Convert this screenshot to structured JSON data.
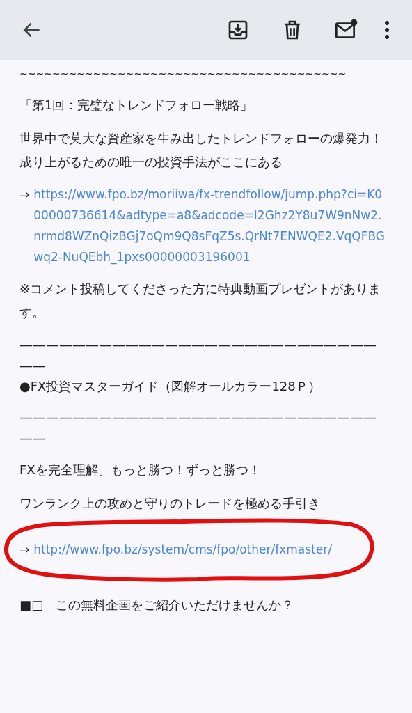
{
  "blocks": [
    {
      "kind": "tilde_rule",
      "text": "~~~~~~~~~~~~~~~~~~~~~~~~~~~~~~~~~~~~~~~~"
    },
    {
      "kind": "text",
      "text": "「第1回：完璧なトレンドフォロー戦略」"
    },
    {
      "kind": "lines",
      "lines": [
        "世界中で莫大な資産家を生み出したトレンドフォローの爆発力！",
        "成り上がるための唯一の投資手法がここにある"
      ]
    },
    {
      "kind": "link",
      "prefix": "⇒",
      "circled": false,
      "url": "https://www.fpo.bz/moriiwa/fx-trendfollow/jump.php?ci=K000000736614&adtype=a8&adcode=I2Ghz2Y8u7W9nNw2.nrmd8WZnQizBGj7oQm9Q8sFqZ5s.QrNt7ENWQE2.VqQFBGwq2-NuQEbh_1pxs00000003196001"
    },
    {
      "kind": "text",
      "text": "※コメント投稿してくださった方に特典動画プレゼントがあります。"
    },
    {
      "kind": "rule_text",
      "text": "—————————————————————————————"
    },
    {
      "kind": "heading",
      "text": "●FX投資マスターガイド（図解オールカラー128Ｐ）"
    },
    {
      "kind": "rule_text",
      "text": "—————————————————————————————"
    },
    {
      "kind": "text",
      "text": "FXを完全理解。もっと勝つ！ずっと勝つ！"
    },
    {
      "kind": "text",
      "text": "ワンランク上の攻めと守りのトレードを極める手引き"
    },
    {
      "kind": "link",
      "prefix": "⇒",
      "circled": true,
      "url": "http://www.fpo.bz/system/cms/fpo/other/fxmaster/"
    },
    {
      "kind": "text",
      "text": "■□　この無料企画をご紹介いただけませんか？"
    },
    {
      "kind": "dashes",
      "text": "------------------------------------------------------------"
    }
  ]
}
